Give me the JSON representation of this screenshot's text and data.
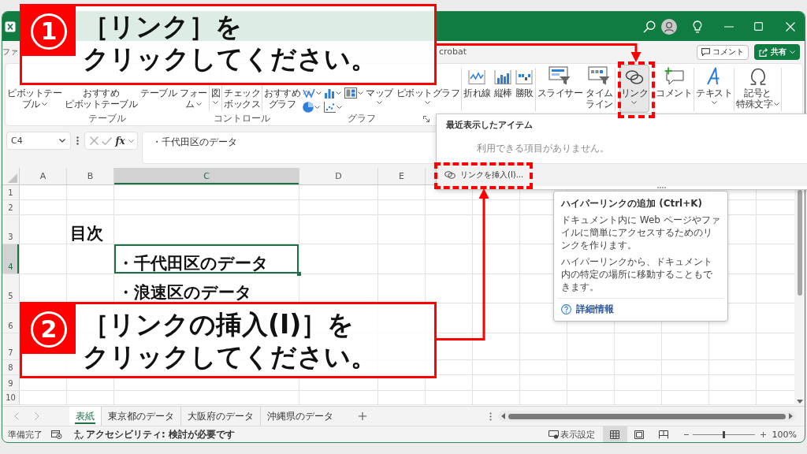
{
  "ribbon": {
    "tabs": [
      {
        "label": "ファ",
        "selected": false
      },
      {
        "label": "crobat",
        "selected": false
      }
    ],
    "comment_button": "コメント",
    "share_button": "共有",
    "groups": [
      {
        "label": "テーブル",
        "buttons": [
          {
            "kind": "large",
            "lines": [
              "ピボットテー",
              "ブル"
            ],
            "dropdown": true,
            "pressed": false
          },
          {
            "kind": "large",
            "lines": [
              "おすすめ",
              "ピボットテーブル"
            ],
            "pressed": false
          },
          {
            "kind": "large",
            "lines": [
              "テーブル"
            ],
            "pressed": false
          },
          {
            "kind": "large",
            "lines": [
              "フォー",
              "ム"
            ],
            "dropdown": true,
            "pressed": false
          }
        ]
      },
      {
        "buttons": [
          {
            "kind": "large",
            "lines": [
              "図"
            ],
            "dropdown": true,
            "pressed": false
          }
        ]
      },
      {
        "label": "コントロール",
        "buttons": [
          {
            "kind": "large",
            "lines": [
              "チェック",
              "ボックス"
            ],
            "pressed": false
          }
        ]
      },
      {
        "label": "グラフ",
        "launcher": true,
        "buttons": [
          {
            "kind": "large",
            "lines": [
              "おすすめ",
              "グラフ"
            ],
            "pressed": false
          },
          {
            "kind": "small",
            "dropdown": true,
            "pressed": false
          },
          {
            "kind": "small",
            "dropdown": true,
            "pressed": false
          },
          {
            "kind": "small",
            "dropdown": true,
            "pressed": false
          },
          {
            "kind": "small",
            "dropdown": true,
            "pressed": false
          },
          {
            "kind": "small",
            "dropdown": true,
            "pressed": false
          },
          {
            "kind": "large",
            "lines": [
              "マップ"
            ],
            "dropdown": true,
            "pressed": false
          },
          {
            "kind": "large",
            "lines": [
              "ピボットグラフ"
            ],
            "dropdown": true,
            "pressed": false
          }
        ]
      },
      {
        "buttons": [
          {
            "kind": "large",
            "lines": [
              "折れ線"
            ],
            "pressed": false
          },
          {
            "kind": "large",
            "lines": [
              "縦棒"
            ],
            "pressed": false
          },
          {
            "kind": "large",
            "lines": [
              "勝敗"
            ],
            "pressed": false
          }
        ]
      },
      {
        "buttons": [
          {
            "kind": "large",
            "lines": [
              "スライサー"
            ],
            "pressed": false
          },
          {
            "kind": "large",
            "lines": [
              "タイム",
              "ライン"
            ],
            "pressed": false
          }
        ]
      },
      {
        "buttons": [
          {
            "kind": "large",
            "lines": [
              "リンク"
            ],
            "dropdown": true,
            "pressed": true
          }
        ]
      },
      {
        "buttons": [
          {
            "kind": "large",
            "lines": [
              "コメント"
            ],
            "pressed": false
          }
        ]
      },
      {
        "buttons": [
          {
            "kind": "large",
            "lines": [
              "テキスト"
            ],
            "dropdown": true,
            "pressed": false
          }
        ]
      },
      {
        "buttons": [
          {
            "kind": "large",
            "lines": [
              "記号と",
              "特殊文字"
            ],
            "dropdown": true,
            "pressed": false
          }
        ]
      }
    ]
  },
  "link_menu": {
    "heading": "最近表示したアイテム",
    "empty_note": "利用できる項目がありません。",
    "items": [
      {
        "label": "リンクを挿入(I)...",
        "highlighted": true
      }
    ]
  },
  "tooltip": {
    "title": "ハイパーリンクの追加 (Ctrl+K)",
    "paragraphs": [
      "ドキュメント内に Web ページやファイルに簡単にアクセスするためのリンクを作ります。",
      "ハイパーリンクから、ドキュメント内の特定の場所に移動することもできます。"
    ],
    "link": "詳細情報"
  },
  "sheet": {
    "name_box": "C4",
    "function_label": "fx",
    "formula": "・千代田区のデータ",
    "columns": [
      {
        "label": "A",
        "selected": false
      },
      {
        "label": "B",
        "selected": false
      },
      {
        "label": "C",
        "selected": true
      },
      {
        "label": "D",
        "selected": false
      },
      {
        "label": "E",
        "selected": false
      }
    ],
    "rows": [
      {
        "label": "1",
        "selected": false
      },
      {
        "label": "2",
        "selected": false
      },
      {
        "label": "3",
        "selected": false,
        "cells": [
          null,
          "目次"
        ]
      },
      {
        "label": "4",
        "selected": true,
        "cells": [
          null,
          null,
          "・千代田区のデータ"
        ]
      },
      {
        "label": "5",
        "selected": false,
        "cells": [
          null,
          null,
          "・浪速区のデータ"
        ]
      },
      {
        "label": "6",
        "selected": false
      },
      {
        "label": "7",
        "selected": false
      },
      {
        "label": "8",
        "selected": false
      },
      {
        "label": "9",
        "selected": false
      },
      {
        "label": "10",
        "selected": false
      }
    ]
  },
  "sheet_tabs": [
    {
      "label": "表紙",
      "selected": true
    },
    {
      "label": "東京都のデータ",
      "selected": false
    },
    {
      "label": "大阪府のデータ",
      "selected": false
    },
    {
      "label": "沖縄県のデータ",
      "selected": false
    }
  ],
  "status_bar": {
    "mode": "準備完了",
    "accessibility": "アクセシビリティ: 検討が必要です",
    "display_settings": "表示設定",
    "views": [
      {
        "kind": "normal",
        "selected": true
      },
      {
        "kind": "page_layout",
        "selected": false
      },
      {
        "kind": "page_break",
        "selected": false
      }
    ],
    "zoom": {
      "level": 0.5,
      "reading": "100%"
    }
  },
  "callouts": [
    {
      "number": "1",
      "lines": [
        "［リンク］を",
        "クリックしてください。"
      ]
    },
    {
      "number": "2",
      "lines": [
        "［リンクの挿入(I)］を",
        "クリックしてください。"
      ]
    }
  ]
}
